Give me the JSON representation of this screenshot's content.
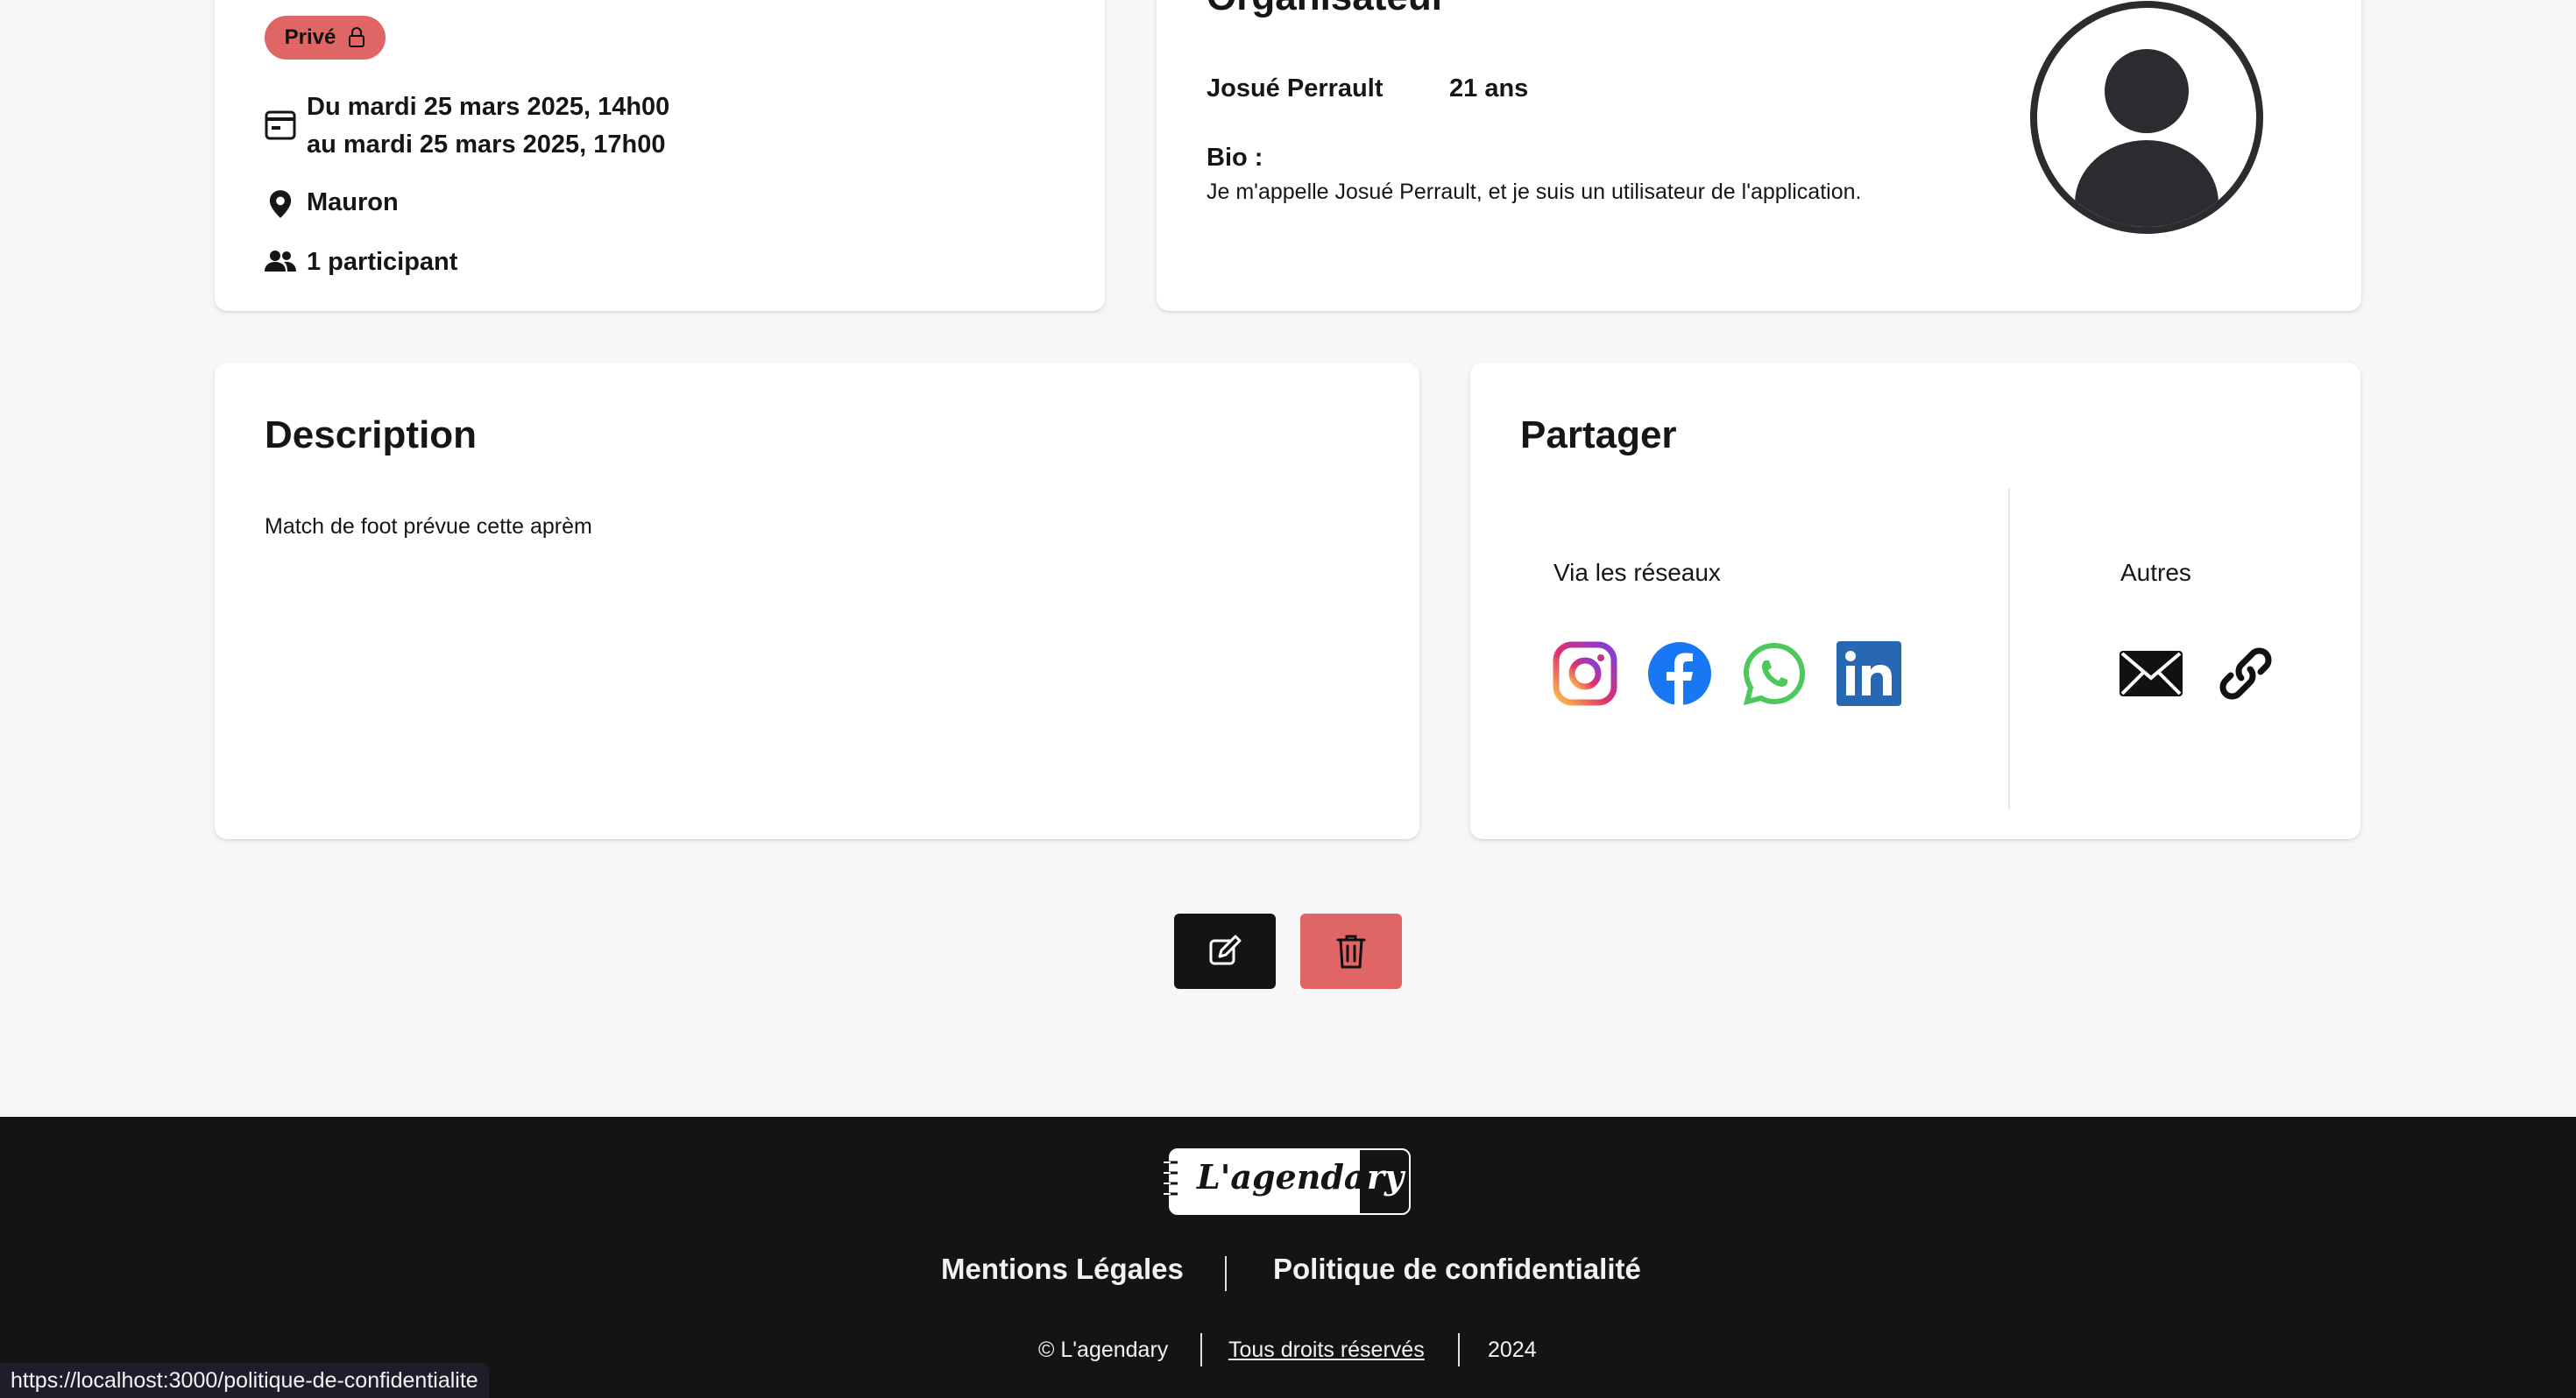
{
  "event": {
    "privacy_label": "Privé",
    "date_line1": "Du mardi 25 mars 2025, 14h00",
    "date_line2": "au mardi 25 mars 2025, 17h00",
    "location": "Mauron",
    "participants": "1 participant"
  },
  "organizer": {
    "heading": "Organisateur",
    "name": "Josué Perrault",
    "age": "21 ans",
    "bio_label": "Bio :",
    "bio_text": "Je m'appelle Josué Perrault, et je suis un utilisateur de l'application."
  },
  "description": {
    "title": "Description",
    "text": "Match de foot prévue cette aprèm"
  },
  "share": {
    "title": "Partager",
    "networks_label": "Via les réseaux",
    "others_label": "Autres",
    "networks": [
      "instagram-icon",
      "facebook-icon",
      "whatsapp-icon",
      "linkedin-icon"
    ],
    "others": [
      "envelope-icon",
      "link-icon"
    ]
  },
  "actions": {
    "edit_icon": "pencil-icon",
    "delete_icon": "trash-icon",
    "edit_color": "#141414",
    "delete_color": "#e06666"
  },
  "footer": {
    "logo_text_main": "L'agenda",
    "logo_text_end": "ry",
    "legal_link": "Mentions Légales",
    "privacy_link": "Politique de confidentialité",
    "copyright": "© L'agendary",
    "rights": "Tous droits réservés",
    "year": "2024"
  },
  "status_bar": {
    "url": "https://localhost:3000/politique-de-confidentialite"
  },
  "colors": {
    "accent_red": "#e06666",
    "dark": "#141414",
    "instagram": "#d6249f",
    "facebook": "#1877f2",
    "whatsapp": "#4cc95a",
    "linkedin": "#2867b2"
  }
}
